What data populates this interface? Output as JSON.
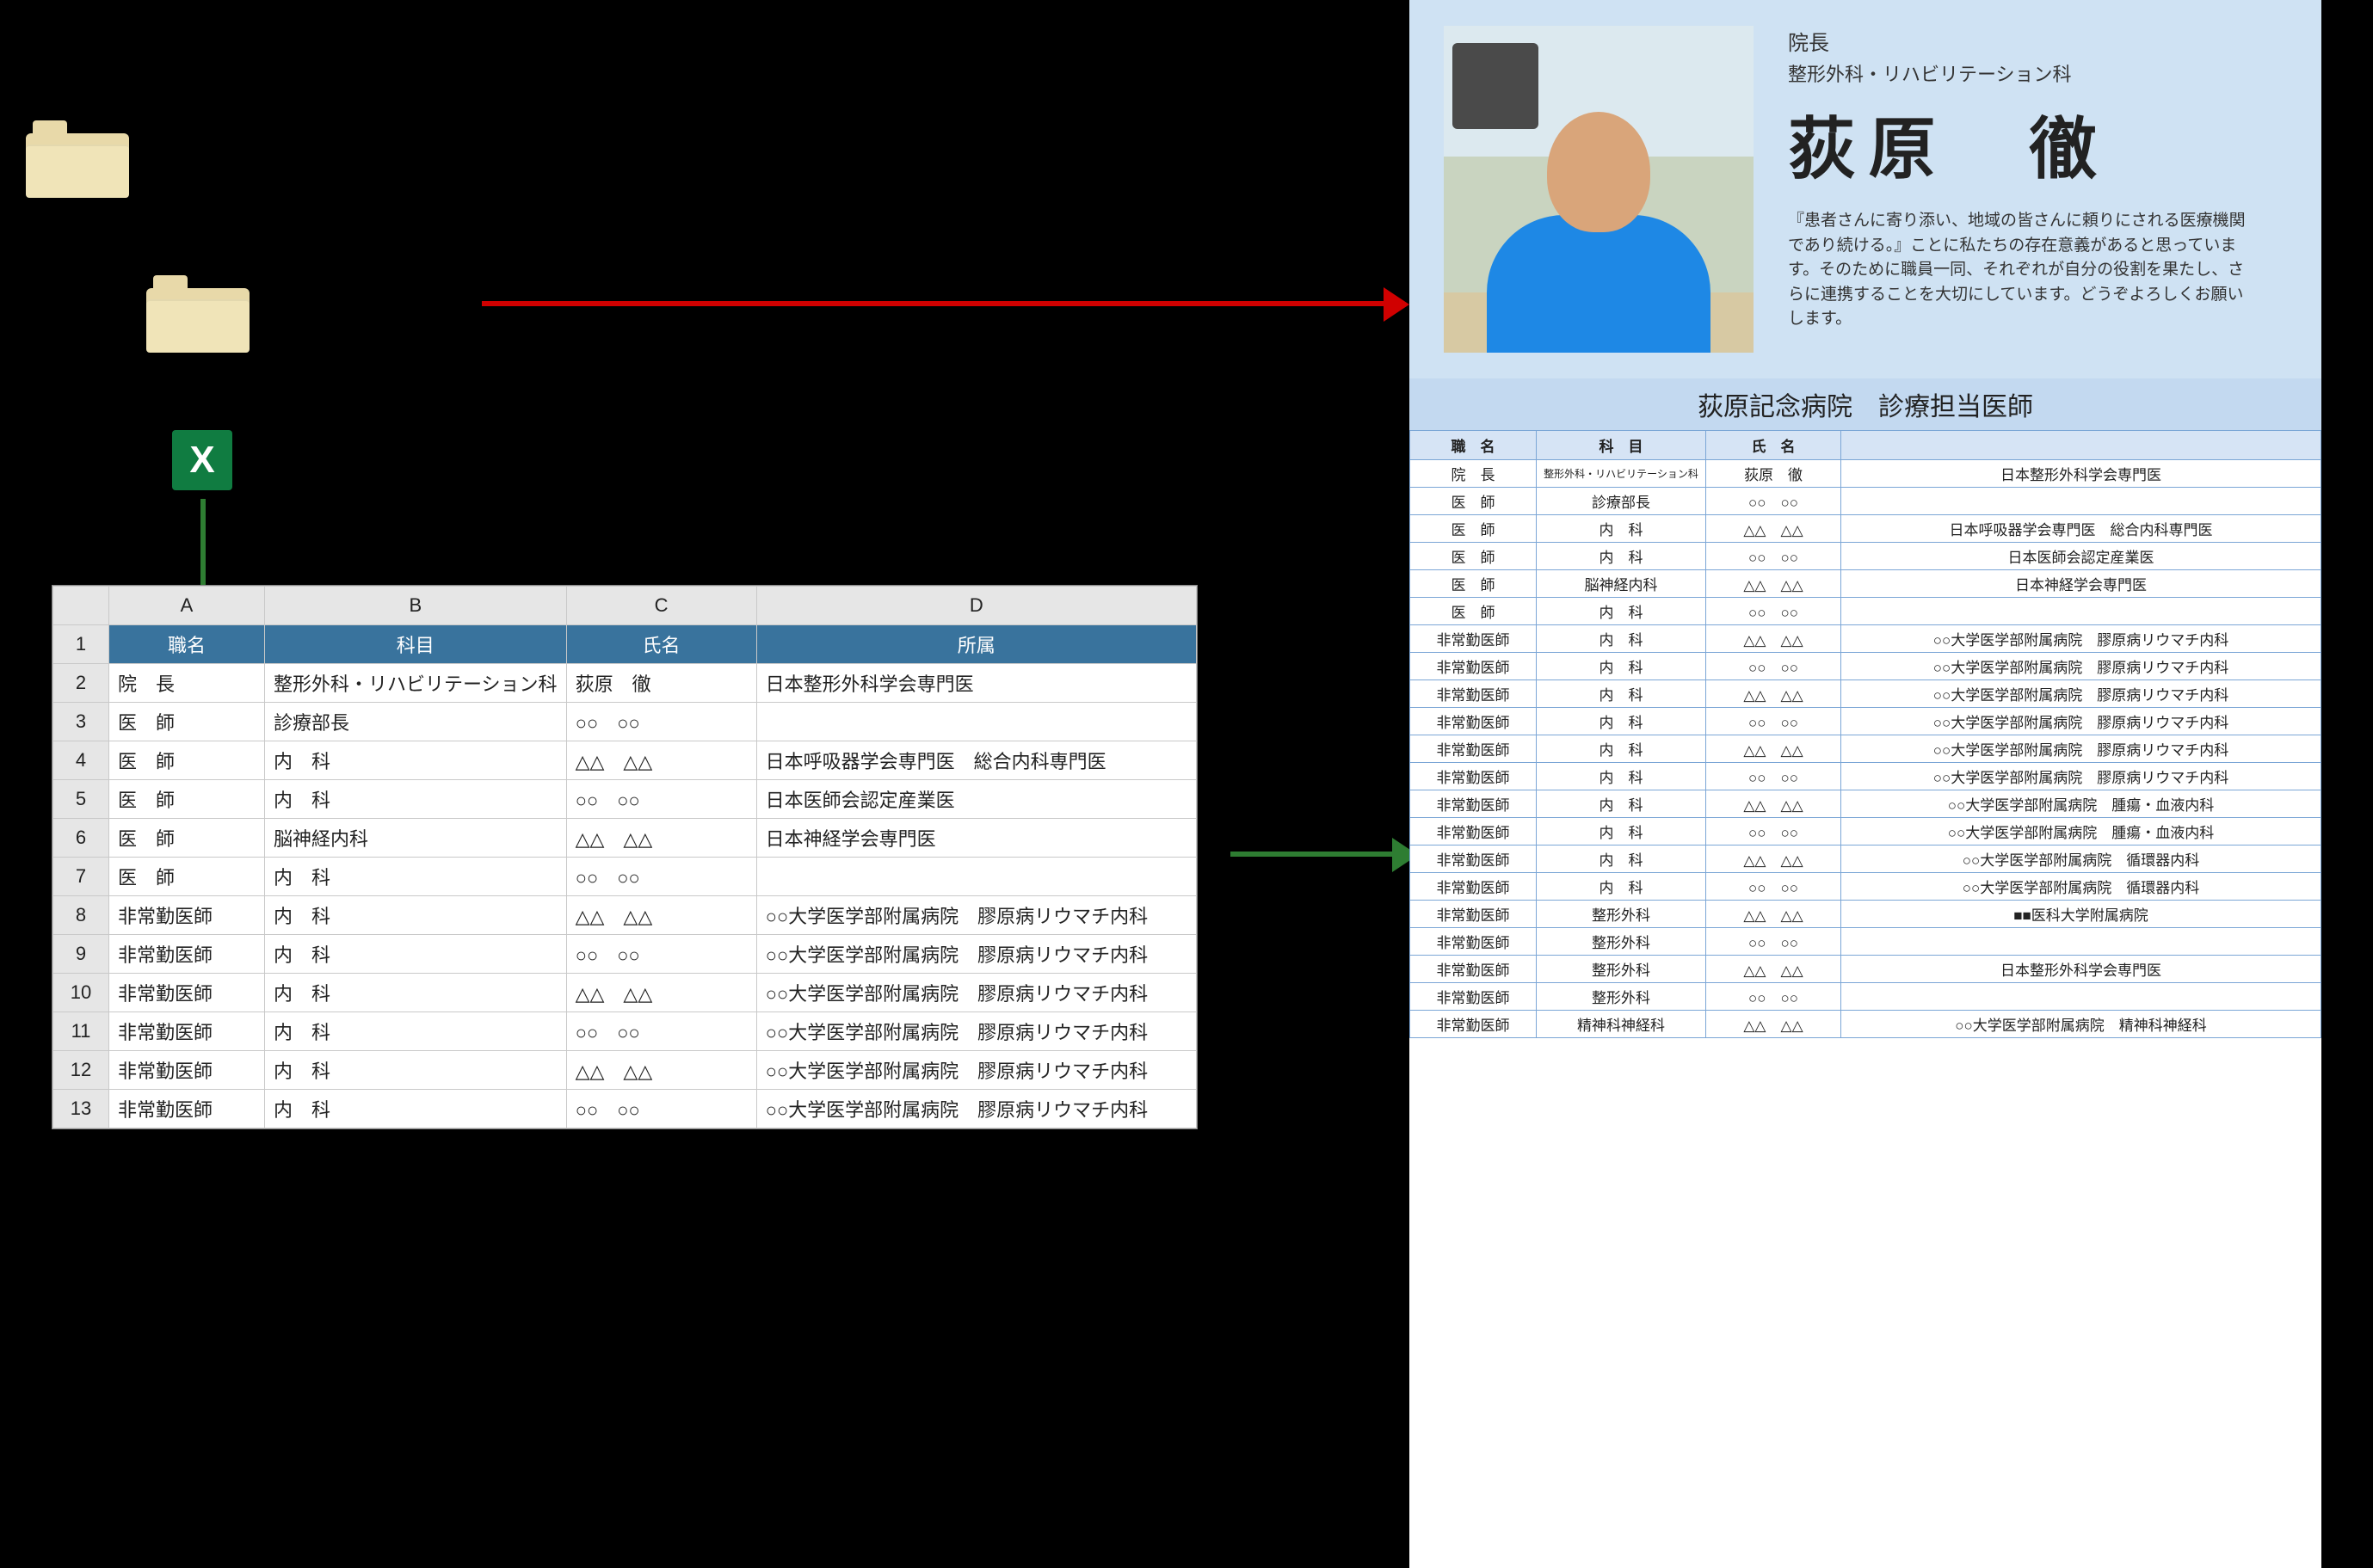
{
  "excel_mark": "X",
  "spreadsheet": {
    "cols": [
      "A",
      "B",
      "C",
      "D"
    ],
    "headers": [
      "職名",
      "科目",
      "氏名",
      "所属"
    ],
    "rows": [
      [
        "院　長",
        "整形外科・リハビリテーション科",
        "荻原　徹",
        "日本整形外科学会専門医"
      ],
      [
        "医　師",
        "診療部長",
        "○○　○○",
        ""
      ],
      [
        "医　師",
        "内　科",
        "△△　△△",
        "日本呼吸器学会専門医　総合内科専門医"
      ],
      [
        "医　師",
        "内　科",
        "○○　○○",
        "日本医師会認定産業医"
      ],
      [
        "医　師",
        "脳神経内科",
        "△△　△△",
        "日本神経学会専門医"
      ],
      [
        "医　師",
        "内　科",
        "○○　○○",
        ""
      ],
      [
        "非常勤医師",
        "内　科",
        "△△　△△",
        "○○大学医学部附属病院　膠原病リウマチ内科"
      ],
      [
        "非常勤医師",
        "内　科",
        "○○　○○",
        "○○大学医学部附属病院　膠原病リウマチ内科"
      ],
      [
        "非常勤医師",
        "内　科",
        "△△　△△",
        "○○大学医学部附属病院　膠原病リウマチ内科"
      ],
      [
        "非常勤医師",
        "内　科",
        "○○　○○",
        "○○大学医学部附属病院　膠原病リウマチ内科"
      ],
      [
        "非常勤医師",
        "内　科",
        "△△　△△",
        "○○大学医学部附属病院　膠原病リウマチ内科"
      ],
      [
        "非常勤医師",
        "内　科",
        "○○　○○",
        "○○大学医学部附属病院　膠原病リウマチ内科"
      ]
    ]
  },
  "card": {
    "role": "院長",
    "dept": "整形外科・リハビリテーション科",
    "name": "荻原　徹",
    "message": "『患者さんに寄り添い、地域の皆さんに頼りにされる医療機関であり続ける。』ことに私たちの存在意義があると思っています。そのために職員一同、それぞれが自分の役割を果たし、さらに連携することを大切にしています。どうぞよろしくお願いします。"
  },
  "doctor_list": {
    "title": "荻原記念病院　診療担当医師",
    "headers": [
      "職　名",
      "科　目",
      "氏　名",
      ""
    ],
    "rows": [
      [
        "院　長",
        "整形外科・リハビリテーション科",
        "荻原　徹",
        "日本整形外科学会専門医"
      ],
      [
        "医　師",
        "診療部長",
        "○○　○○",
        ""
      ],
      [
        "医　師",
        "内　科",
        "△△　△△",
        "日本呼吸器学会専門医　総合内科専門医"
      ],
      [
        "医　師",
        "内　科",
        "○○　○○",
        "日本医師会認定産業医"
      ],
      [
        "医　師",
        "脳神経内科",
        "△△　△△",
        "日本神経学会専門医"
      ],
      [
        "医　師",
        "内　科",
        "○○　○○",
        ""
      ],
      [
        "非常勤医師",
        "内　科",
        "△△　△△",
        "○○大学医学部附属病院　膠原病リウマチ内科"
      ],
      [
        "非常勤医師",
        "内　科",
        "○○　○○",
        "○○大学医学部附属病院　膠原病リウマチ内科"
      ],
      [
        "非常勤医師",
        "内　科",
        "△△　△△",
        "○○大学医学部附属病院　膠原病リウマチ内科"
      ],
      [
        "非常勤医師",
        "内　科",
        "○○　○○",
        "○○大学医学部附属病院　膠原病リウマチ内科"
      ],
      [
        "非常勤医師",
        "内　科",
        "△△　△△",
        "○○大学医学部附属病院　膠原病リウマチ内科"
      ],
      [
        "非常勤医師",
        "内　科",
        "○○　○○",
        "○○大学医学部附属病院　膠原病リウマチ内科"
      ],
      [
        "非常勤医師",
        "内　科",
        "△△　△△",
        "○○大学医学部附属病院　腫瘍・血液内科"
      ],
      [
        "非常勤医師",
        "内　科",
        "○○　○○",
        "○○大学医学部附属病院　腫瘍・血液内科"
      ],
      [
        "非常勤医師",
        "内　科",
        "△△　△△",
        "○○大学医学部附属病院　循環器内科"
      ],
      [
        "非常勤医師",
        "内　科",
        "○○　○○",
        "○○大学医学部附属病院　循環器内科"
      ],
      [
        "非常勤医師",
        "整形外科",
        "△△　△△",
        "■■医科大学附属病院"
      ],
      [
        "非常勤医師",
        "整形外科",
        "○○　○○",
        ""
      ],
      [
        "非常勤医師",
        "整形外科",
        "△△　△△",
        "日本整形外科学会専門医"
      ],
      [
        "非常勤医師",
        "整形外科",
        "○○　○○",
        ""
      ],
      [
        "非常勤医師",
        "精神科神経科",
        "△△　△△",
        "○○大学医学部附属病院　精神科神経科"
      ]
    ]
  }
}
